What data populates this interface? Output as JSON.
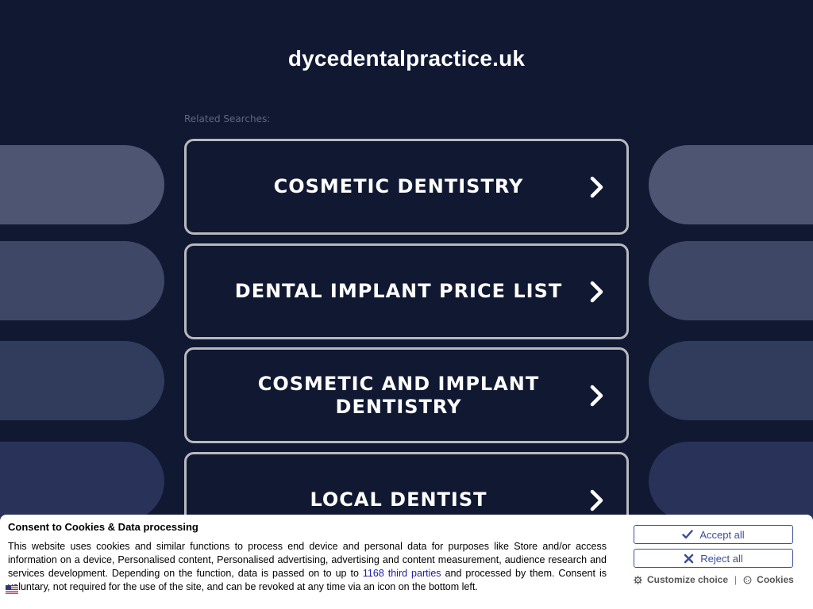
{
  "header": {
    "domain": "dycedentalpractice.uk",
    "related_label": "Related Searches:"
  },
  "search_links": [
    {
      "label": "COSMETIC DENTISTRY"
    },
    {
      "label": "DENTAL IMPLANT PRICE LIST"
    },
    {
      "label": "COSMETIC AND IMPLANT DENTISTRY"
    },
    {
      "label": "LOCAL DENTIST"
    }
  ],
  "consent": {
    "title": "Consent to Cookies & Data processing",
    "text_before_link": "This website uses cookies and similar functions to process end device and personal data for purposes like Store and/or access information on a device, Personalised content, Personalised advertising, advertising and content measurement, audience research and services development. Depending on the function, data is passed on to up to ",
    "link_text": "1168 third parties",
    "text_after_link": " and processed by them. Consent is voluntary, not required for the use of the site, and can be revoked at any time via an icon on the bottom left.",
    "accept_label": "Accept all",
    "reject_label": "Reject all",
    "customize_label": "Customize choice",
    "separator": "|",
    "cookies_label": "Cookies"
  },
  "icons": {
    "chevron": "chevron-right-icon",
    "accept": "check-icon",
    "reject": "x-icon",
    "customize": "gear-icon",
    "cookies": "cookie-icon",
    "flag": "uk-flag-icon"
  },
  "colors": {
    "background": "#111832",
    "text": "#ffffff",
    "box_border": "#b8b9bf",
    "consent_accent": "#3a4e9a"
  }
}
